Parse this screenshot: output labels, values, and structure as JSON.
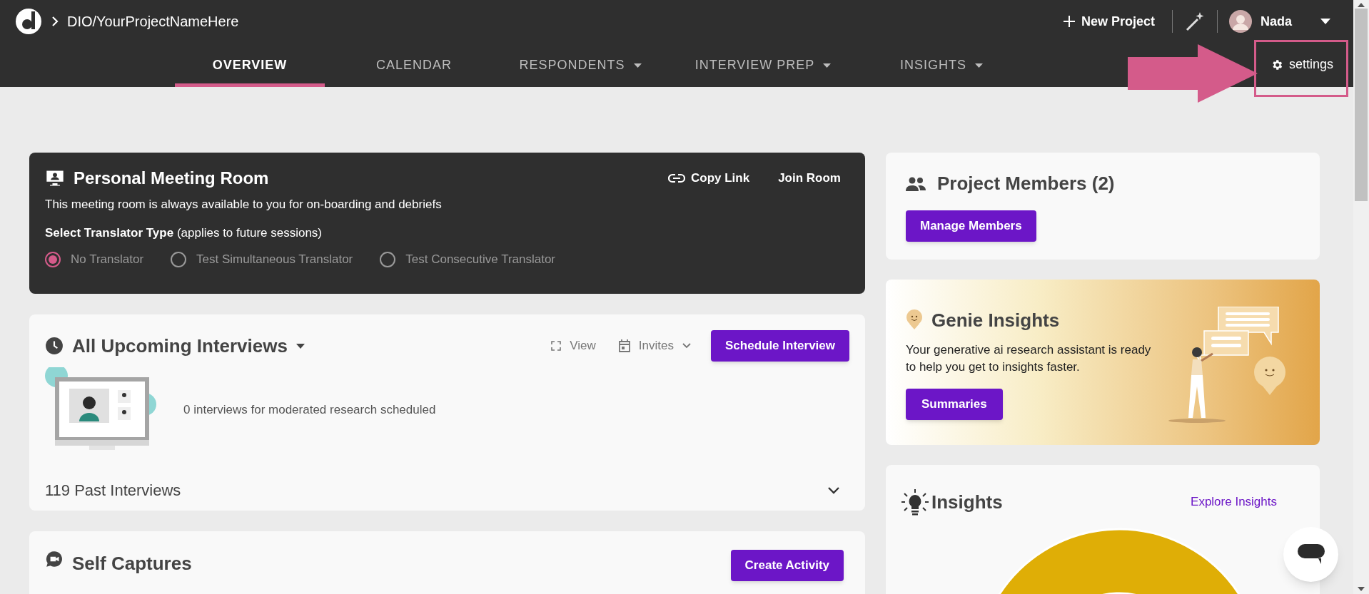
{
  "header": {
    "breadcrumb": "DIO/YourProjectNameHere",
    "new_project": "New Project",
    "user_name": "Nada",
    "settings": "settings"
  },
  "tabs": [
    {
      "label": "OVERVIEW",
      "selected": true,
      "dropdown": false
    },
    {
      "label": "CALENDAR",
      "selected": false,
      "dropdown": false
    },
    {
      "label": "RESPONDENTS",
      "selected": false,
      "dropdown": true
    },
    {
      "label": "INTERVIEW PREP",
      "selected": false,
      "dropdown": true
    },
    {
      "label": "INSIGHTS",
      "selected": false,
      "dropdown": true
    }
  ],
  "meeting_room": {
    "title": "Personal Meeting Room",
    "copy_link": "Copy Link",
    "join_room": "Join Room",
    "description": "This meeting room is always available to you for on-boarding and debriefs",
    "translator_label": "**Select Translator Type** (applies to future sessions)",
    "translators": [
      {
        "label": "No Translator",
        "selected": true
      },
      {
        "label": "Test Simultaneous Translator",
        "selected": false
      },
      {
        "label": "Test Consecutive Translator",
        "selected": false
      }
    ]
  },
  "upcoming": {
    "title": "All Upcoming Interviews",
    "view": "View",
    "invites": "Invites",
    "schedule_button": "Schedule Interview",
    "empty_message": "0 interviews for moderated research scheduled",
    "past_interviews": "119 Past Interviews"
  },
  "self_captures": {
    "title": "Self Captures",
    "button": "Create Activity"
  },
  "members": {
    "title": "Project Members (2)",
    "button": "Manage Members"
  },
  "genie": {
    "title": "Genie Insights",
    "description": "Your generative ai research assistant is ready to help you get to insights faster.",
    "button": "Summaries"
  },
  "insights": {
    "title": "Insights",
    "link": "Explore Insights"
  }
}
